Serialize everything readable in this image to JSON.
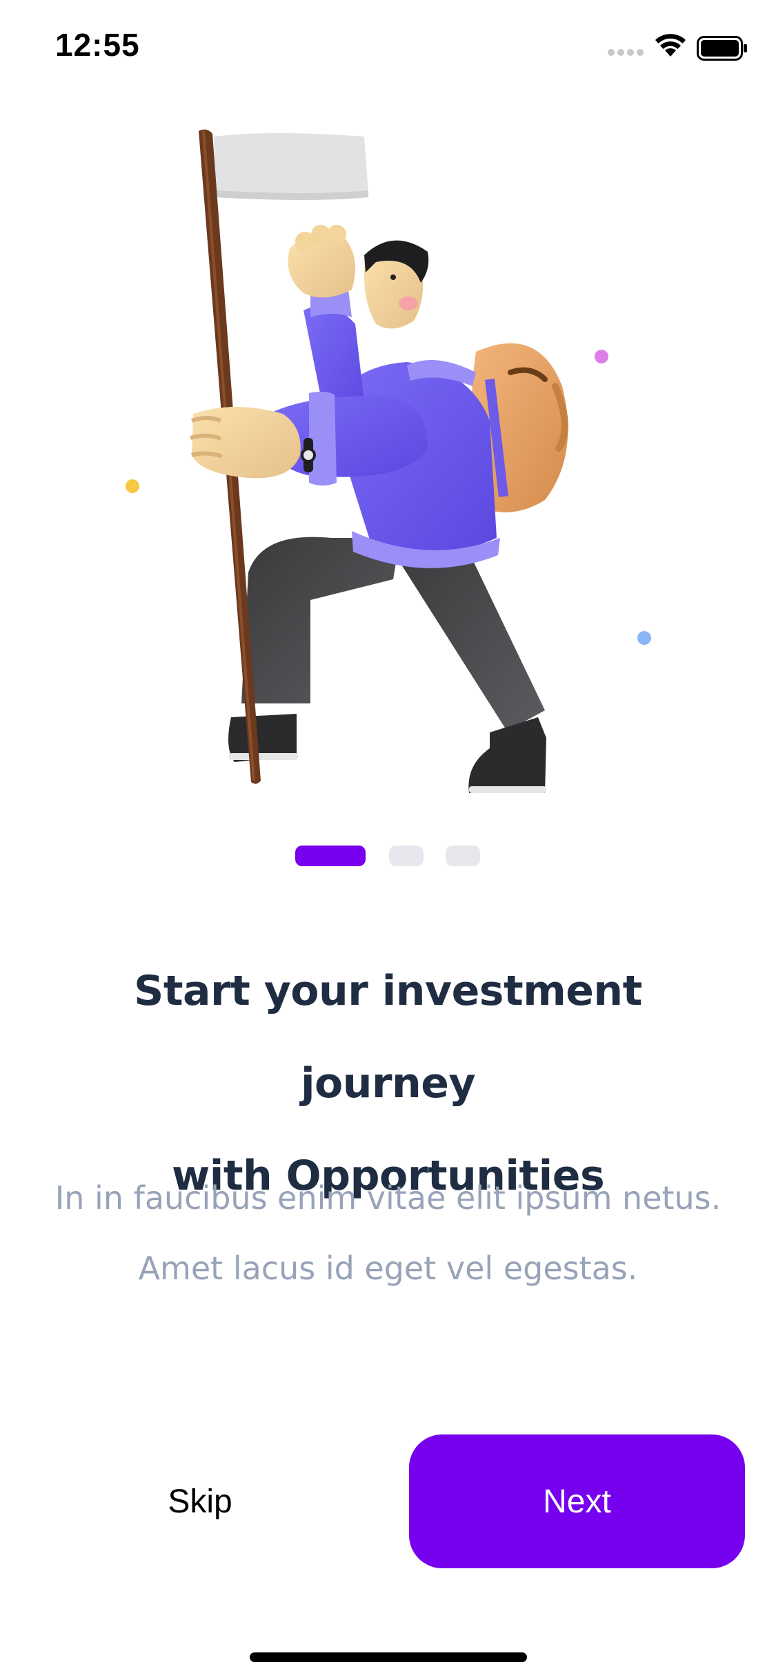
{
  "status_bar": {
    "time": "12:55",
    "icons": [
      "signal-dots-icon",
      "wifi-icon",
      "battery-icon"
    ]
  },
  "illustration": {
    "subject": "hiker-with-flag-illustration",
    "accent_dots": [
      "#f6c844",
      "#dd7ee8",
      "#8ab6f3"
    ]
  },
  "pager": {
    "current_page": 1,
    "total_pages": 3,
    "active_color": "#7700ee",
    "inactive_color": "#e6e8ee"
  },
  "onboarding": {
    "title_line1": "Start your investment journey",
    "title_line2": "with Opportunities",
    "subtitle_line1": "In in faucibus enim vitae elit ipsum netus.",
    "subtitle_line2": "Amet lacus id eget vel egestas."
  },
  "actions": {
    "skip_label": "Skip",
    "next_label": "Next",
    "primary_color": "#7700ee"
  }
}
